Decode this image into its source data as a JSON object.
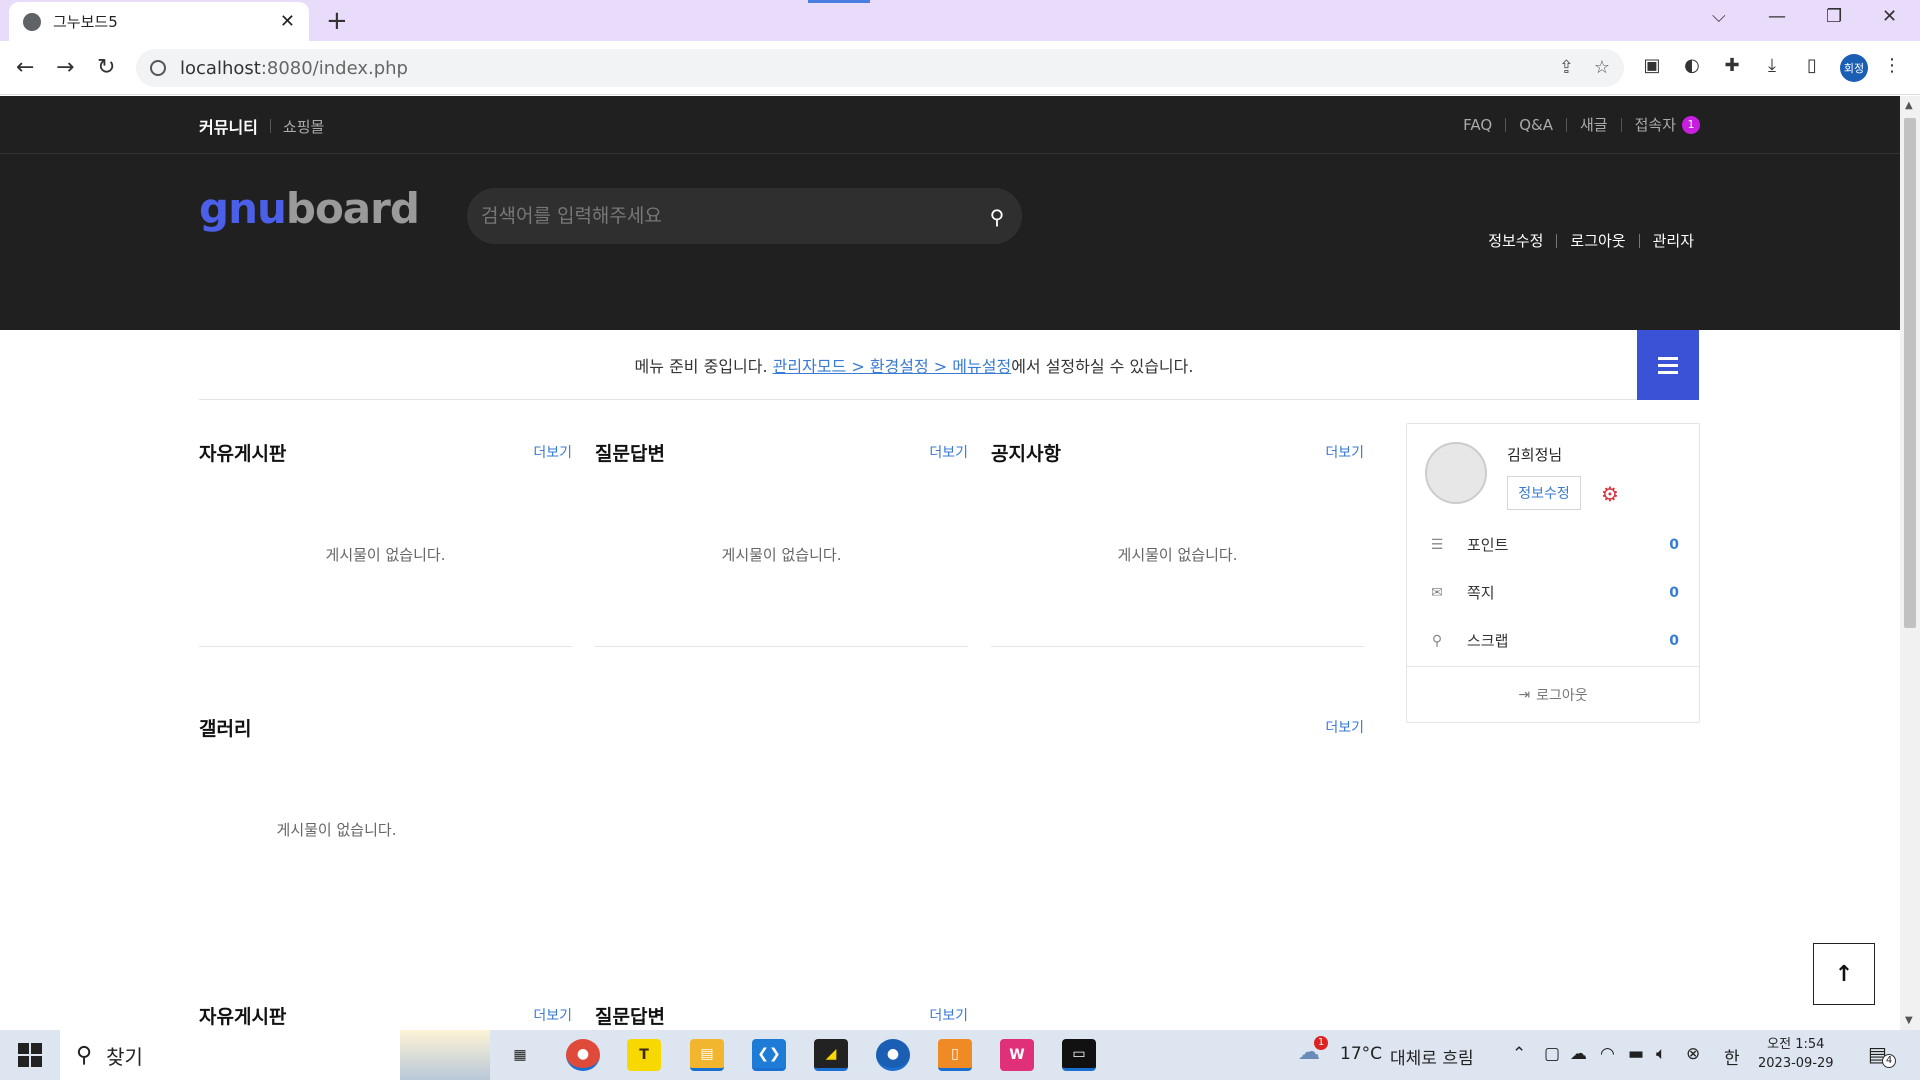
{
  "browser": {
    "tab_title": "그누보드5",
    "url_host": "localhost",
    "url_rest": ":8080/index.php",
    "profile_label": "회정"
  },
  "topnav": {
    "left": [
      "커뮤니티",
      "쇼핑몰"
    ],
    "right": [
      "FAQ",
      "Q&A",
      "새글",
      "접속자"
    ],
    "visitor_count": "1"
  },
  "header": {
    "logo_g": "gnu",
    "logo_b": "board",
    "search_placeholder": "검색어를 입력해주세요",
    "links": [
      "정보수정",
      "로그아웃",
      "관리자"
    ]
  },
  "menubar": {
    "prefix": "메뉴 준비 중입니다. ",
    "link": "관리자모드 > 환경설정 > 메뉴설정",
    "suffix": "에서 설정하실 수 있습니다."
  },
  "boards": {
    "more": "더보기",
    "empty": "게시물이 없습니다.",
    "b1": "자유게시판",
    "b2": "질문답변",
    "b3": "공지사항",
    "gallery": "갤러리",
    "b4": "자유게시판",
    "b5": "질문답변"
  },
  "outlogin": {
    "name": "김희정님",
    "edit": "정보수정",
    "rows": [
      {
        "label": "포인트",
        "value": "0"
      },
      {
        "label": "쪽지",
        "value": "0"
      },
      {
        "label": "스크랩",
        "value": "0"
      }
    ],
    "logout": "로그아웃"
  },
  "taskbar": {
    "search": "찾기",
    "weather_temp": "17°C",
    "weather_text": "대체로 흐림",
    "ime": "한",
    "time": "오전 1:54",
    "date": "2023-09-29",
    "notif_count": "4",
    "weather_badge": "1"
  },
  "colors": {
    "header_bg": "#202020",
    "accent_blue": "#3a53d6",
    "link_blue": "#3a7bd5",
    "badge_purple": "#c81ee0"
  }
}
